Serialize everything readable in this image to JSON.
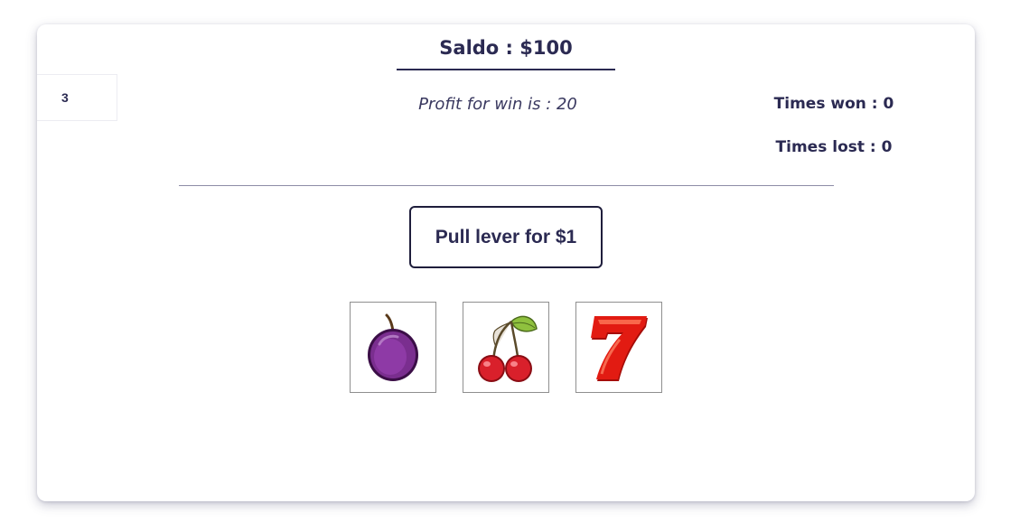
{
  "counter": "3",
  "saldo": "Saldo : $100",
  "profit": "Profit for win is : 20",
  "stats": {
    "won": "Times won : 0",
    "lost": "Times lost : 0"
  },
  "lever_label": "Pull lever for $1",
  "reels": [
    {
      "symbol": "plum-icon"
    },
    {
      "symbol": "cherry-icon"
    },
    {
      "symbol": "seven-icon"
    }
  ],
  "colors": {
    "text": "#2b2a52",
    "plum": "#7a2e8f",
    "cherry": "#d9202b",
    "seven": "#e21b12"
  }
}
